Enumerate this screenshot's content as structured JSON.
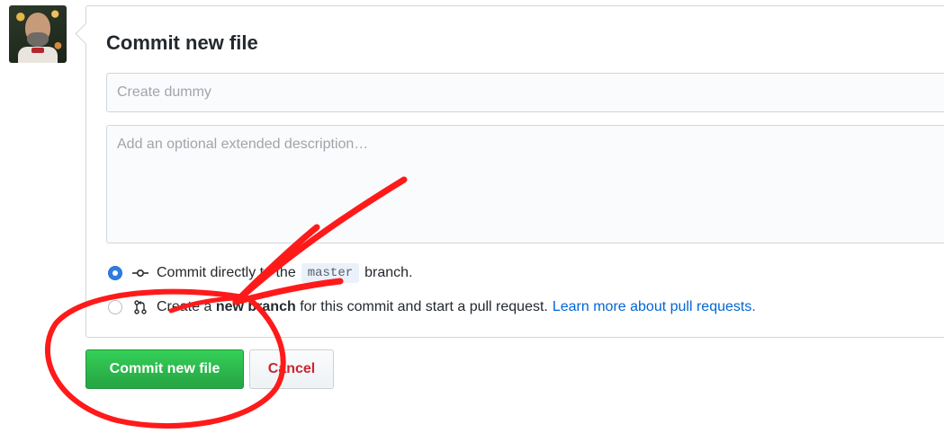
{
  "avatar": {
    "alt": "user avatar"
  },
  "form": {
    "title": "Commit new file",
    "summary_placeholder": "Create dummy",
    "description_placeholder": "Add an optional extended description…"
  },
  "options": {
    "direct": {
      "checked": true,
      "prefix": "Commit directly to the",
      "branch": "master",
      "suffix": "branch.",
      "icon": "git-commit-icon"
    },
    "new_branch": {
      "checked": false,
      "prefix": "Create a",
      "bold": "new branch",
      "suffix": "for this commit and start a pull request.",
      "link": "Learn more about pull requests.",
      "icon": "git-pull-request-icon"
    }
  },
  "buttons": {
    "commit_label": "Commit new file",
    "cancel_label": "Cancel"
  },
  "colors": {
    "primary_green": "#28a745",
    "cancel_red": "#cb2431",
    "link_blue": "#0366d6",
    "annotation_red": "#ff1a1a",
    "radio_blue": "#2f7de1"
  }
}
